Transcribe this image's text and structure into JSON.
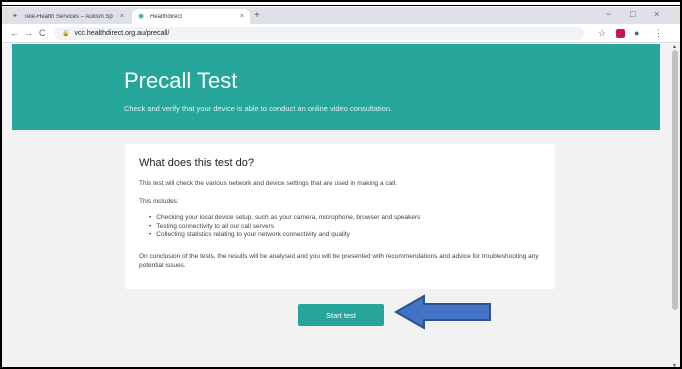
{
  "browser": {
    "tabs": [
      {
        "title": "Tele-Health Services – Autism Sp",
        "active": false
      },
      {
        "title": "Healthdirect",
        "active": true
      }
    ],
    "url": "vcc.healthdirect.org.au/precall/",
    "icons": {
      "back": "←",
      "forward": "→",
      "reload": "C",
      "lock": "🔒",
      "star": "☆",
      "profile": "●",
      "menu": "⋮",
      "minimize": "−",
      "maximize": "□",
      "close": "×",
      "newtab": "+"
    }
  },
  "hero": {
    "title": "Precall Test",
    "subtitle": "Check and verify that your device is able to conduct an online video consultation."
  },
  "card": {
    "heading": "What does this test do?",
    "intro": "This test will check the various network and device settings that are used in making a call.",
    "includes_label": "This includes:",
    "items": [
      "Checking your local device setup, such as your camera, microphone, browser and speakers",
      "Testing connectivity to all our call servers",
      "Collecting statistics relating to your network connectivity and quality"
    ],
    "conclusion": "On conclusion of the tests, the results will be analysed and you will be presented with recommendations and advice for troubleshooting any potential issues."
  },
  "actions": {
    "start_label": "Start test"
  },
  "colors": {
    "accent": "#26a69a",
    "arrow_fill": "#4472c4",
    "arrow_stroke": "#2f528f"
  }
}
